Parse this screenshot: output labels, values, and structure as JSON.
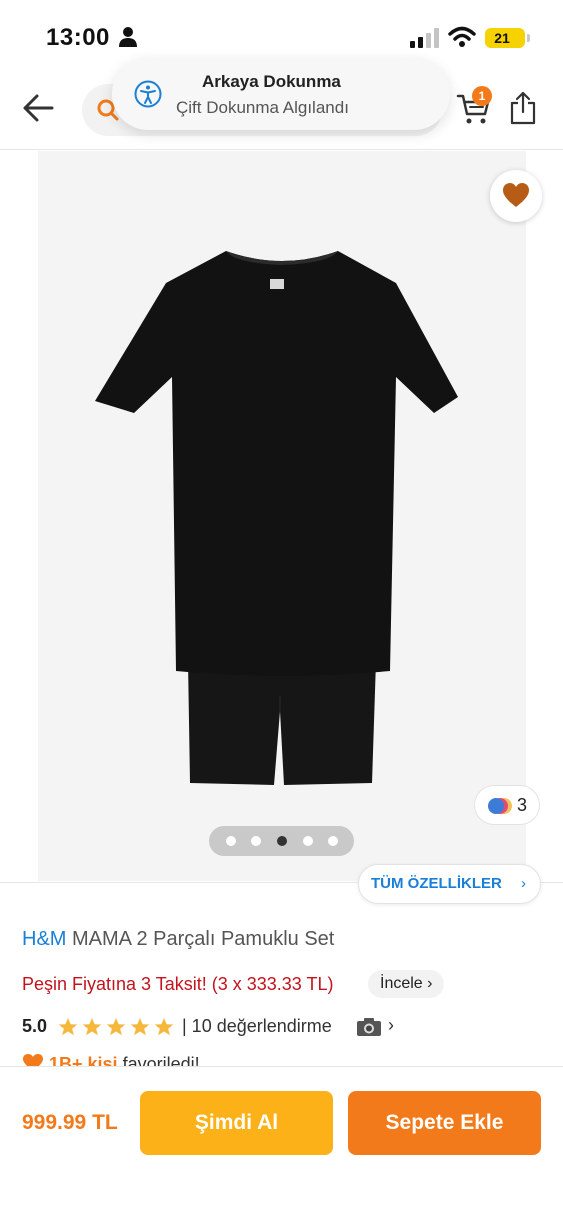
{
  "status_bar": {
    "time": "13:00",
    "battery": "21"
  },
  "header": {
    "back_icon": "arrow-left-icon",
    "search_icon": "search-icon",
    "cart_icon": "cart-icon",
    "cart_badge": "1",
    "share_icon": "share-icon"
  },
  "toast": {
    "icon": "accessibility-icon",
    "title": "Arkaya Dokunma",
    "subtitle": "Çift Dokunma Algılandı"
  },
  "gallery": {
    "favorite_icon": "heart-icon",
    "color_count": "3",
    "page_count": 5,
    "active_page": 3
  },
  "details": {
    "all_features_label": "TÜM ÖZELLİKLER",
    "brand": "H&M",
    "product_name": "MAMA 2 Parçalı Pamuklu Set",
    "installment_text": "Peşin Fiyatına 3 Taksit! (3 x 333.33 TL)",
    "incele_label": "İncele",
    "rating_value": "5.0",
    "rating_stars": 5,
    "reviews_text": "| 10 değerlendirme",
    "favorites_count": "1B+ kişi",
    "favorites_text": " favoriledi!"
  },
  "bottom_bar": {
    "price": "999.99 TL",
    "buy_now_label": "Şimdi Al",
    "add_to_cart_label": "Sepete Ekle"
  },
  "colors": {
    "accent": "#f27a1a",
    "buy_now": "#fbb117",
    "brand_blue": "#1a7fd6",
    "installment_red": "#c4131d",
    "star": "#f6b83c"
  }
}
